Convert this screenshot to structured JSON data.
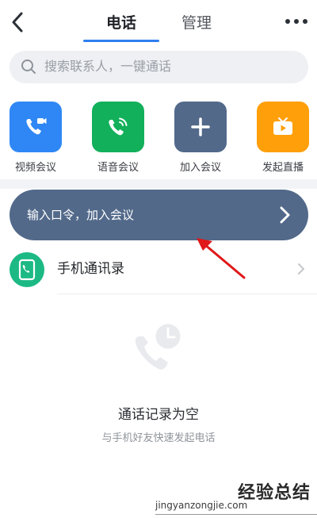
{
  "header": {
    "tabs": [
      {
        "label": "电话",
        "active": true
      },
      {
        "label": "管理",
        "active": false
      }
    ],
    "back_icon": "chevron-left-icon",
    "more_icon": "more-horizontal-icon",
    "accent_color": "#2f7ff0"
  },
  "search": {
    "placeholder": "搜索联系人，一键通话",
    "icon": "search-icon"
  },
  "quick_actions": [
    {
      "label": "视频会议",
      "icon": "video-call-icon",
      "color": "#2f87f5"
    },
    {
      "label": "语音会议",
      "icon": "voice-call-icon",
      "color": "#12b05a"
    },
    {
      "label": "加入会议",
      "icon": "plus-icon",
      "color": "#52698a"
    },
    {
      "label": "发起直播",
      "icon": "tv-live-icon",
      "color": "#ff9f0a"
    }
  ],
  "join_bar": {
    "label": "输入口令，加入会议",
    "icon": "chevron-right-icon",
    "color": "#52698a"
  },
  "contacts": {
    "label": "手机通讯录",
    "icon": "contact-book-icon",
    "color": "#1cb984"
  },
  "empty_state": {
    "icon": "phone-clock-icon",
    "title": "通话记录为空",
    "subtitle": "与手机好友快速发起电话"
  },
  "watermark": {
    "cn": "经验总结",
    "en": "jingyanzongjie.com"
  }
}
